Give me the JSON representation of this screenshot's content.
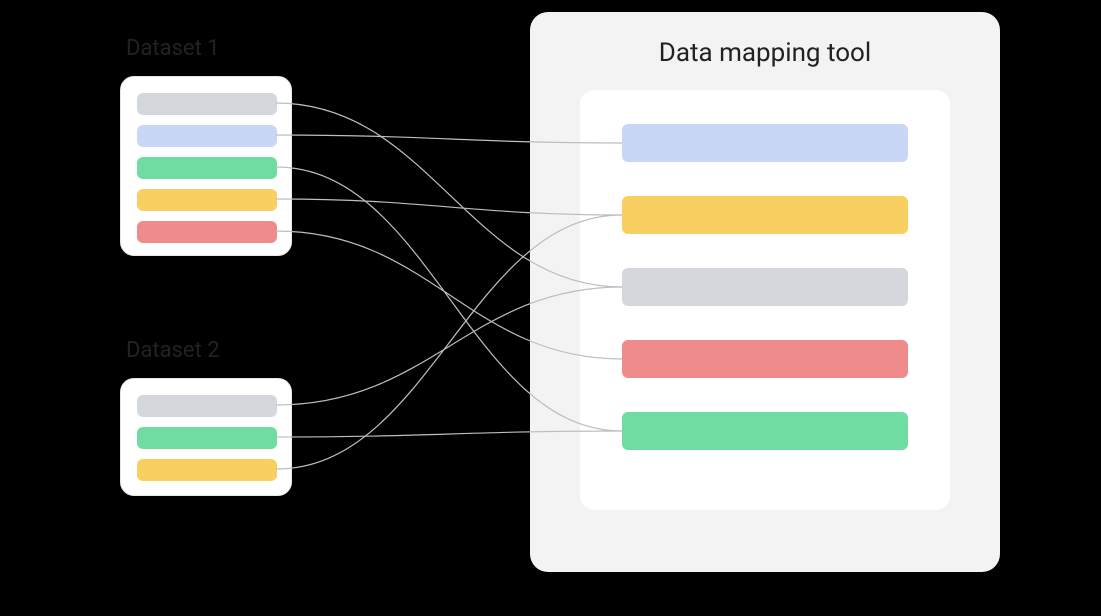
{
  "labels": {
    "dataset1": "Dataset 1",
    "dataset2": "Dataset 2",
    "tool_title": "Data mapping tool"
  },
  "colors": {
    "grey": "#d4d8dc",
    "blue": "#c9d7f6",
    "green": "#6fdda1",
    "yellow": "#f9cf62",
    "red": "#f08b8b"
  },
  "datasets": {
    "d1": {
      "fields": [
        "grey",
        "blue",
        "green",
        "yellow",
        "red"
      ]
    },
    "d2": {
      "fields": [
        "grey",
        "green",
        "yellow"
      ]
    }
  },
  "tool": {
    "fields": [
      "blue",
      "yellow",
      "grey",
      "red",
      "green"
    ]
  },
  "mappings": [
    {
      "from": "d1.0",
      "to": "tool.2",
      "note": "d1 grey -> tool grey"
    },
    {
      "from": "d1.1",
      "to": "tool.0",
      "note": "d1 blue -> tool blue"
    },
    {
      "from": "d1.2",
      "to": "tool.4",
      "note": "d1 green -> tool green"
    },
    {
      "from": "d1.3",
      "to": "tool.1",
      "note": "d1 yellow -> tool yellow"
    },
    {
      "from": "d1.4",
      "to": "tool.3",
      "note": "d1 red -> tool red"
    },
    {
      "from": "d2.0",
      "to": "tool.2",
      "note": "d2 grey -> tool grey"
    },
    {
      "from": "d2.1",
      "to": "tool.4",
      "note": "d2 green -> tool green"
    },
    {
      "from": "d2.2",
      "to": "tool.1",
      "note": "d2 yellow -> tool yellow"
    }
  ]
}
